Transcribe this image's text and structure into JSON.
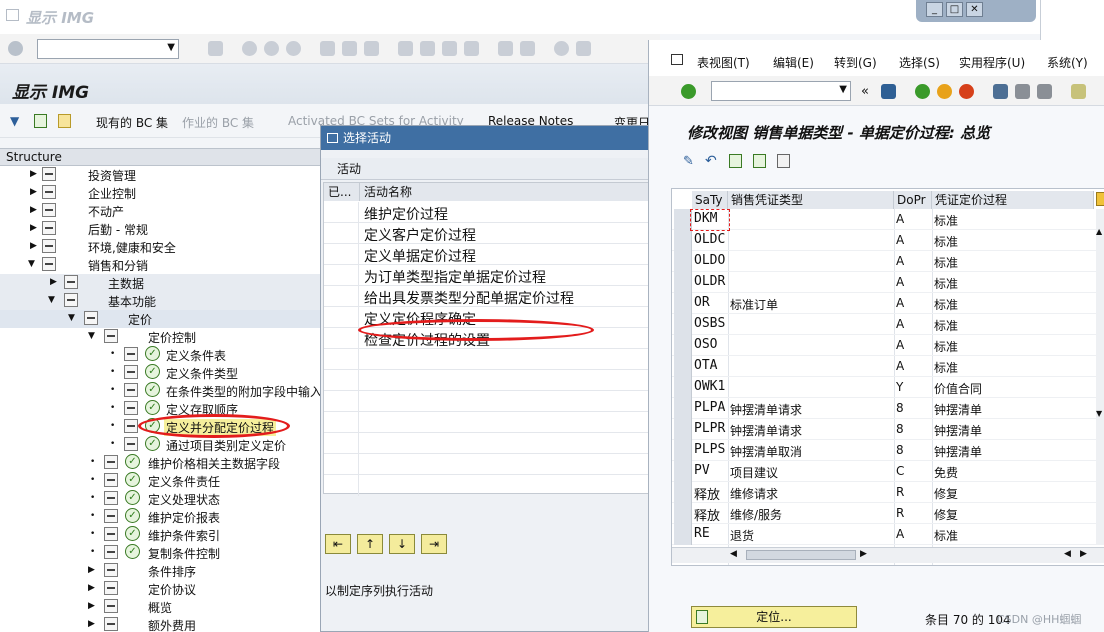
{
  "bg_window": {
    "title": "显示 IMG",
    "header": "显示 IMG",
    "appbar": {
      "bc_sets": "现有的 BC 集",
      "activity_bc": "作业的 BC 集",
      "activated_bc": "Activated BC Sets for Activity",
      "release_notes": "Release Notes",
      "change_log": "变更日"
    },
    "structure_label": "Structure",
    "tree": [
      {
        "label": "投资管理",
        "level": 1
      },
      {
        "label": "企业控制",
        "level": 1
      },
      {
        "label": "不动产",
        "level": 1
      },
      {
        "label": "后勤 - 常规",
        "level": 1
      },
      {
        "label": "环境,健康和安全",
        "level": 1
      },
      {
        "label": "销售和分销",
        "level": 1
      },
      {
        "label": "主数据",
        "level": 2
      },
      {
        "label": "基本功能",
        "level": 2
      },
      {
        "label": "定价",
        "level": 3
      },
      {
        "label": "定价控制",
        "level": 4
      },
      {
        "label": "定义条件表",
        "level": 5
      },
      {
        "label": "定义条件类型",
        "level": 5
      },
      {
        "label": "在条件类型的附加字段中输入",
        "level": 5
      },
      {
        "label": "定义存取顺序",
        "level": 5
      },
      {
        "label": "定义并分配定价过程",
        "level": 5
      },
      {
        "label": "通过项目类别定义定价",
        "level": 5
      },
      {
        "label": "维护价格相关主数据字段",
        "level": 4
      },
      {
        "label": "定义条件责任",
        "level": 4
      },
      {
        "label": "定义处理状态",
        "level": 4
      },
      {
        "label": "维护定价报表",
        "level": 4
      },
      {
        "label": "维护条件索引",
        "level": 4
      },
      {
        "label": "复制条件控制",
        "level": 4
      },
      {
        "label": "条件排序",
        "level": 4
      },
      {
        "label": "定价协议",
        "level": 4
      },
      {
        "label": "概览",
        "level": 4
      },
      {
        "label": "额外费用",
        "level": 4
      }
    ]
  },
  "popup": {
    "title": "选择活动",
    "subheader": "活动",
    "col_done": "已...",
    "col_name": "活动名称",
    "activities": [
      "维护定价过程",
      "定义客户定价过程",
      "定义单据定价过程",
      "为订单类型指定单据定价过程",
      "给出具发票类型分配单据定价过程",
      "定义定价程序确定",
      "检查定价过程的设置"
    ],
    "note": "以制定序列执行活动"
  },
  "main_window": {
    "menu": [
      "表视图(T)",
      "编辑(E)",
      "转到(G)",
      "选择(S)",
      "实用程序(U)",
      "系统(Y)"
    ],
    "title": "修改视图 销售单据类型 - 单据定价过程: 总览",
    "columns": [
      "SaTy",
      "销售凭证类型",
      "DoPr",
      "凭证定价过程"
    ],
    "rows": [
      {
        "saty": "DKM",
        "desc": "",
        "dopr": "A",
        "proc": "标准"
      },
      {
        "saty": "OLDC",
        "desc": "",
        "dopr": "A",
        "proc": "标准"
      },
      {
        "saty": "OLDO",
        "desc": "",
        "dopr": "A",
        "proc": "标准"
      },
      {
        "saty": "OLDR",
        "desc": "",
        "dopr": "A",
        "proc": "标准"
      },
      {
        "saty": "OR",
        "desc": "标准订单",
        "dopr": "A",
        "proc": "标准"
      },
      {
        "saty": "OSBS",
        "desc": "",
        "dopr": "A",
        "proc": "标准"
      },
      {
        "saty": "OSO",
        "desc": "",
        "dopr": "A",
        "proc": "标准"
      },
      {
        "saty": "OTA",
        "desc": "",
        "dopr": "A",
        "proc": "标准"
      },
      {
        "saty": "OWK1",
        "desc": "",
        "dopr": "Y",
        "proc": "价值合同"
      },
      {
        "saty": "PLPA",
        "desc": "钟摆清单请求",
        "dopr": "8",
        "proc": "钟摆清单"
      },
      {
        "saty": "PLPR",
        "desc": "钟摆清单请求",
        "dopr": "8",
        "proc": "钟摆清单"
      },
      {
        "saty": "PLPS",
        "desc": "钟摆清单取消",
        "dopr": "8",
        "proc": "钟摆清单"
      },
      {
        "saty": "PV",
        "desc": "项目建议",
        "dopr": "C",
        "proc": "免费"
      },
      {
        "saty": "释放",
        "desc": "维修请求",
        "dopr": "R",
        "proc": "修复"
      },
      {
        "saty": "释放",
        "desc": "维修/服务",
        "dopr": "R",
        "proc": "修复"
      },
      {
        "saty": "RE",
        "desc": "退货",
        "dopr": "A",
        "proc": "标准"
      }
    ],
    "position_button": "定位...",
    "entry_info": "条目 70 的 104",
    "watermark": "CSDN @HH蝈蝈"
  },
  "colors": {
    "accent": "#3f6fa3",
    "highlight": "#e31c1c",
    "button_yellow": "#f6ef9c"
  }
}
